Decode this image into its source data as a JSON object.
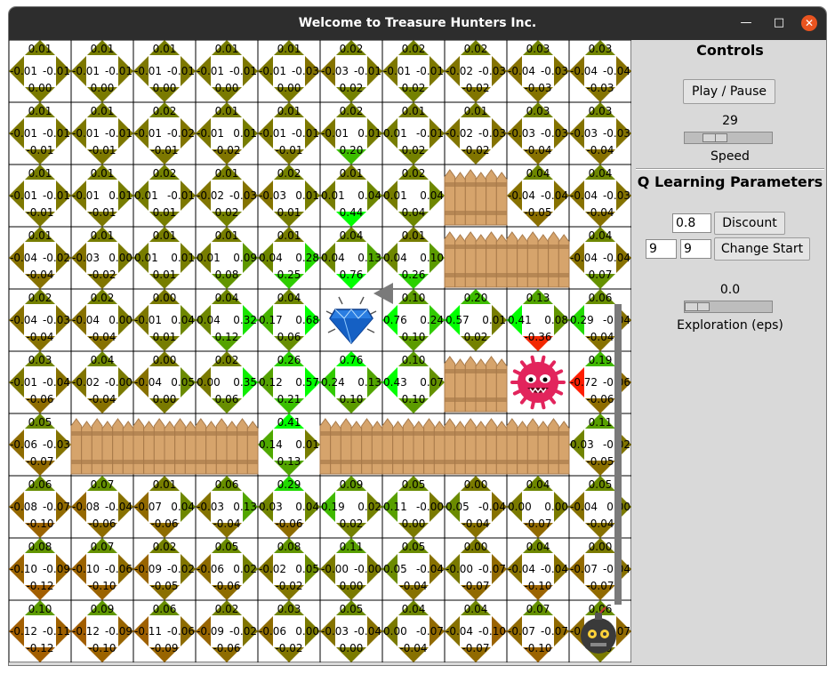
{
  "window": {
    "title": "Welcome to Treasure Hunters Inc."
  },
  "controls": {
    "heading": "Controls",
    "play_pause_label": "Play / Pause",
    "speed_value": "29",
    "speed_label": "Speed",
    "speed_fraction": 0.29
  },
  "q_params": {
    "heading": "Q Learning Parameters",
    "discount_value": "0.8",
    "discount_button": "Discount",
    "start_row": "9",
    "start_col": "9",
    "change_start_button": "Change Start",
    "eps_value": "0.0",
    "eps_label": "Exploration (eps)",
    "eps_fraction": 0.0
  },
  "grid": {
    "rows": 10,
    "cols": 10,
    "fence_cells": [
      [
        2,
        7
      ],
      [
        3,
        7
      ],
      [
        3,
        8
      ],
      [
        5,
        7
      ],
      [
        6,
        1
      ],
      [
        6,
        2
      ],
      [
        6,
        3
      ],
      [
        6,
        5
      ],
      [
        6,
        6
      ],
      [
        6,
        7
      ],
      [
        6,
        8
      ]
    ],
    "treasure_cell": [
      4,
      5
    ],
    "monster_cell": [
      5,
      8
    ],
    "agent_cell": [
      9,
      9
    ],
    "cells": [
      [
        [
          "0.01",
          "-0.01",
          "-0.01",
          "0.00"
        ],
        [
          "0.01",
          "-0.01",
          "-0.01",
          "0.00"
        ],
        [
          "0.01",
          "-0.01",
          "-0.01",
          "0.00"
        ],
        [
          "0.01",
          "-0.01",
          "-0.01",
          "0.00"
        ],
        [
          "0.01",
          "-0.01",
          "-0.03",
          "0.00"
        ],
        [
          "0.02",
          "-0.03",
          "-0.01",
          "0.02"
        ],
        [
          "0.02",
          "-0.01",
          "-0.01",
          "0.02"
        ],
        [
          "0.02",
          "-0.02",
          "-0.03",
          "-0.02"
        ],
        [
          "0.03",
          "-0.04",
          "-0.03",
          "-0.03"
        ],
        [
          "0.03",
          "-0.04",
          "-0.04",
          "-0.03"
        ]
      ],
      [
        [
          "0.01",
          "-0.01",
          "-0.01",
          "-0.01"
        ],
        [
          "0.01",
          "-0.01",
          "-0.01",
          "-0.01"
        ],
        [
          "0.02",
          "-0.01",
          "-0.02",
          "-0.01"
        ],
        [
          "0.01",
          "-0.01",
          "0.01",
          "-0.02"
        ],
        [
          "0.01",
          "-0.01",
          "-0.01",
          "-0.01"
        ],
        [
          "0.02",
          "-0.01",
          "0.01",
          "0.20"
        ],
        [
          "0.01",
          "0.01",
          "-0.01",
          "0.02"
        ],
        [
          "0.01",
          "-0.02",
          "-0.03",
          "-0.02"
        ],
        [
          "0.03",
          "-0.03",
          "-0.03",
          "-0.04"
        ],
        [
          "0.03",
          "-0.03",
          "-0.03",
          "-0.04"
        ]
      ],
      [
        [
          "0.01",
          "-0.01",
          "-0.01",
          "-0.01"
        ],
        [
          "0.01",
          "-0.01",
          "0.01",
          "-0.01"
        ],
        [
          "0.02",
          "0.01",
          "-0.01",
          "0.01"
        ],
        [
          "0.01",
          "-0.02",
          "-0.03",
          "0.02"
        ],
        [
          "0.02",
          "-0.03",
          "0.01",
          "0.01"
        ],
        [
          "0.01",
          "0.01",
          "0.04",
          "0.44"
        ],
        [
          "0.02",
          "0.01",
          "0.04",
          "0.04"
        ],
        null,
        [
          "0.04",
          "-0.04",
          "-0.04",
          "-0.05"
        ],
        [
          "0.04",
          "-0.04",
          "-0.03",
          "-0.04"
        ]
      ],
      [
        [
          "0.01",
          "-0.04",
          "-0.02",
          "-0.04"
        ],
        [
          "0.01",
          "-0.03",
          "0.00",
          "-0.02"
        ],
        [
          "0.01",
          "0.01",
          "0.01",
          "0.01"
        ],
        [
          "0.01",
          "0.01",
          "0.09",
          "0.08"
        ],
        [
          "0.01",
          "0.04",
          "0.28",
          "0.25"
        ],
        [
          "0.04",
          "0.04",
          "0.13",
          "0.76"
        ],
        [
          "0.01",
          "0.04",
          "0.10",
          "0.26"
        ],
        null,
        null,
        [
          "0.04",
          "-0.04",
          "-0.04",
          "0.07"
        ]
      ],
      [
        [
          "0.02",
          "-0.04",
          "-0.03",
          "-0.04"
        ],
        [
          "0.02",
          "-0.04",
          "0.00",
          "-0.04"
        ],
        [
          "0.00",
          "-0.01",
          "0.04",
          "0.01"
        ],
        [
          "0.04",
          "0.04",
          "0.32",
          "0.12"
        ],
        [
          "0.04",
          "0.17",
          "0.68",
          "0.06"
        ],
        null,
        [
          "0.10",
          "0.76",
          "0.24",
          "0.10"
        ],
        [
          "0.20",
          "0.57",
          "0.01",
          "0.02"
        ],
        [
          "0.13",
          "0.41",
          "0.08",
          "-0.36"
        ],
        [
          "0.06",
          "0.29",
          "-0.04",
          "-0.04"
        ]
      ],
      [
        [
          "0.03",
          "-0.01",
          "-0.04",
          "-0.06"
        ],
        [
          "0.04",
          "-0.02",
          "-0.00",
          "-0.04"
        ],
        [
          "0.00",
          "-0.04",
          "0.05",
          "0.00"
        ],
        [
          "0.02",
          "0.00",
          "0.35",
          "0.06"
        ],
        [
          "0.26",
          "0.12",
          "0.57",
          "0.21"
        ],
        [
          "0.76",
          "0.24",
          "0.13",
          "0.10"
        ],
        [
          "0.10",
          "0.43",
          "0.07",
          "0.10"
        ],
        null,
        null,
        [
          "0.19",
          "-0.72",
          "-0.06",
          "-0.06"
        ]
      ],
      [
        [
          "0.05",
          "-0.06",
          "-0.03",
          "-0.07"
        ],
        null,
        null,
        null,
        [
          "0.41",
          "0.14",
          "0.01",
          "0.13"
        ],
        null,
        null,
        null,
        null,
        [
          "0.11",
          "0.03",
          "-0.02",
          "-0.05"
        ]
      ],
      [
        [
          "0.06",
          "-0.08",
          "-0.07",
          "-0.10"
        ],
        [
          "0.07",
          "-0.08",
          "-0.04",
          "-0.06"
        ],
        [
          "0.01",
          "-0.07",
          "0.04",
          "-0.06"
        ],
        [
          "0.06",
          "-0.03",
          "0.13",
          "-0.04"
        ],
        [
          "0.29",
          "0.03",
          "0.04",
          "-0.06"
        ],
        [
          "0.09",
          "0.19",
          "0.02",
          "0.02"
        ],
        [
          "0.05",
          "0.11",
          "-0.00",
          "0.00"
        ],
        [
          "0.00",
          "0.05",
          "-0.04",
          "-0.04"
        ],
        [
          "0.04",
          "0.00",
          "0.00",
          "-0.07"
        ],
        [
          "0.05",
          "-0.04",
          "0.00",
          "-0.04"
        ]
      ],
      [
        [
          "0.08",
          "-0.10",
          "-0.09",
          "-0.12"
        ],
        [
          "0.07",
          "-0.10",
          "-0.06",
          "-0.10"
        ],
        [
          "0.02",
          "-0.09",
          "-0.02",
          "-0.05"
        ],
        [
          "0.05",
          "-0.06",
          "0.02",
          "-0.06"
        ],
        [
          "0.08",
          "-0.02",
          "0.05",
          "-0.02"
        ],
        [
          "0.11",
          "-0.00",
          "-0.00",
          "0.00"
        ],
        [
          "0.05",
          "0.05",
          "-0.04",
          "-0.04"
        ],
        [
          "0.00",
          "-0.00",
          "-0.07",
          "-0.07"
        ],
        [
          "0.04",
          "-0.04",
          "-0.04",
          "-0.10"
        ],
        [
          "0.00",
          "-0.07",
          "-0.04",
          "-0.07"
        ]
      ],
      [
        [
          "0.10",
          "-0.12",
          "-0.11",
          "-0.12"
        ],
        [
          "0.09",
          "-0.12",
          "-0.09",
          "-0.10"
        ],
        [
          "0.06",
          "-0.11",
          "-0.06",
          "-0.09"
        ],
        [
          "0.02",
          "-0.09",
          "-0.02",
          "-0.06"
        ],
        [
          "0.03",
          "-0.06",
          "0.00",
          "-0.02"
        ],
        [
          "0.05",
          "-0.03",
          "-0.04",
          "0.00"
        ],
        [
          "0.04",
          "0.00",
          "-0.07",
          "-0.04"
        ],
        [
          "0.04",
          "-0.04",
          "-0.10",
          "-0.07"
        ],
        [
          "0.07",
          "-0.07",
          "-0.07",
          "-0.10"
        ],
        [
          "0.06",
          "-0.06",
          "-0.07",
          "0.00"
        ]
      ]
    ]
  },
  "path": {
    "cells": [
      [
        9,
        9
      ],
      [
        4,
        9
      ],
      [
        4,
        5
      ]
    ]
  },
  "colors": {
    "neutral": "#7a7a00",
    "positive": "#00ff00",
    "negative": "#ff1e00",
    "fence_light": "#d6a46c",
    "fence_dark": "#a87a4a",
    "path": "#7a7a7a",
    "monster": "#e2245c",
    "gem": "#2a7de1"
  },
  "icons": {
    "treasure": "diamond-icon",
    "monster": "monster-icon",
    "agent": "bomb-robot-icon"
  }
}
